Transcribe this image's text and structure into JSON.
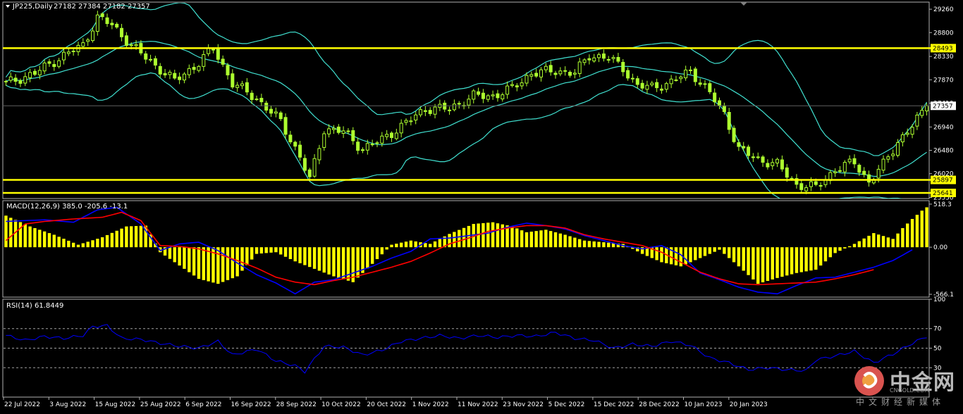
{
  "chart_data": [
    {
      "type": "candlestick",
      "title": "JP225,Daily",
      "ohlc_summary": [
        "27182",
        "27384",
        "27182",
        "27357"
      ],
      "ylim": [
        25530,
        29400
      ],
      "y_ticks": [
        "29260",
        "28800",
        "28330",
        "27870",
        "27410",
        "26940",
        "26480",
        "26020",
        "25550"
      ],
      "x_labels": [
        "22 Jul 2022",
        "3 Aug 2022",
        "15 Aug 2022",
        "25 Aug 2022",
        "6 Sep 2022",
        "16 Sep 2022",
        "28 Sep 2022",
        "10 Oct 2022",
        "20 Oct 2022",
        "1 Nov 2022",
        "11 Nov 2022",
        "23 Nov 2022",
        "5 Dec 2022",
        "15 Dec 2022",
        "28 Dec 2022",
        "10 Jan 2023",
        "20 Jan 2023"
      ],
      "horizontal_levels": [
        28493,
        25897,
        25641
      ],
      "horizontal_level_color": "#ffff00",
      "last_price": 27357,
      "candle_color": "#adff2f",
      "band_color": "#40e0d0",
      "close_keypoints": [
        [
          0,
          27800
        ],
        [
          6,
          28000
        ],
        [
          12,
          28350
        ],
        [
          16,
          28550
        ],
        [
          19,
          29100
        ],
        [
          22,
          28950
        ],
        [
          26,
          28550
        ],
        [
          31,
          28150
        ],
        [
          35,
          27850
        ],
        [
          40,
          28200
        ],
        [
          43,
          28500
        ],
        [
          47,
          27800
        ],
        [
          52,
          27500
        ],
        [
          57,
          27050
        ],
        [
          61,
          26350
        ],
        [
          63,
          25900
        ],
        [
          66,
          26900
        ],
        [
          70,
          26850
        ],
        [
          74,
          26500
        ],
        [
          78,
          26700
        ],
        [
          82,
          26950
        ],
        [
          87,
          27300
        ],
        [
          92,
          27300
        ],
        [
          97,
          27550
        ],
        [
          101,
          27550
        ],
        [
          105,
          27700
        ],
        [
          109,
          28000
        ],
        [
          114,
          28050
        ],
        [
          118,
          28000
        ],
        [
          121,
          28350
        ],
        [
          125,
          28300
        ],
        [
          128,
          28100
        ],
        [
          131,
          27750
        ],
        [
          134,
          27720
        ],
        [
          138,
          27820
        ],
        [
          142,
          28050
        ],
        [
          146,
          27600
        ],
        [
          149,
          27200
        ],
        [
          152,
          26500
        ],
        [
          156,
          26300
        ],
        [
          160,
          26200
        ],
        [
          164,
          25800
        ],
        [
          168,
          25750
        ],
        [
          172,
          26100
        ],
        [
          176,
          26250
        ],
        [
          179,
          25850
        ],
        [
          182,
          26200
        ],
        [
          185,
          26650
        ],
        [
          188,
          26950
        ],
        [
          191,
          27357
        ]
      ]
    },
    {
      "type": "histogram+line",
      "title": "MACD(12,26,9) 385.0 -205.6 -13.1",
      "ylim": [
        -600,
        560
      ],
      "y_ticks": [
        "518.3",
        "0.00",
        "-566.1"
      ],
      "histogram_color": "#ffff00",
      "macd_line_color": "#0000ff",
      "signal_line_color": "#ff0000",
      "histogram_keypoints": [
        [
          0,
          380
        ],
        [
          5,
          250
        ],
        [
          10,
          150
        ],
        [
          15,
          30
        ],
        [
          20,
          120
        ],
        [
          25,
          250
        ],
        [
          29,
          260
        ],
        [
          32,
          -60
        ],
        [
          36,
          -220
        ],
        [
          40,
          -380
        ],
        [
          44,
          -440
        ],
        [
          48,
          -350
        ],
        [
          52,
          -80
        ],
        [
          56,
          -60
        ],
        [
          60,
          -170
        ],
        [
          64,
          -260
        ],
        [
          68,
          -350
        ],
        [
          72,
          -420
        ],
        [
          76,
          -200
        ],
        [
          80,
          30
        ],
        [
          84,
          80
        ],
        [
          88,
          40
        ],
        [
          92,
          160
        ],
        [
          97,
          280
        ],
        [
          101,
          300
        ],
        [
          105,
          250
        ],
        [
          108,
          180
        ],
        [
          112,
          210
        ],
        [
          116,
          150
        ],
        [
          120,
          80
        ],
        [
          124,
          60
        ],
        [
          128,
          40
        ],
        [
          132,
          -80
        ],
        [
          136,
          -180
        ],
        [
          140,
          -230
        ],
        [
          144,
          -130
        ],
        [
          148,
          -30
        ],
        [
          152,
          -230
        ],
        [
          156,
          -440
        ],
        [
          160,
          -370
        ],
        [
          164,
          -310
        ],
        [
          168,
          -270
        ],
        [
          172,
          -70
        ],
        [
          176,
          40
        ],
        [
          180,
          170
        ],
        [
          184,
          100
        ],
        [
          186,
          230
        ],
        [
          188,
          340
        ],
        [
          190,
          440
        ],
        [
          191,
          480
        ]
      ],
      "macd_keypoints": [
        [
          0,
          310
        ],
        [
          8,
          330
        ],
        [
          14,
          300
        ],
        [
          19,
          450
        ],
        [
          23,
          480
        ],
        [
          28,
          280
        ],
        [
          32,
          -40
        ],
        [
          36,
          40
        ],
        [
          40,
          60
        ],
        [
          44,
          -40
        ],
        [
          48,
          -190
        ],
        [
          52,
          -330
        ],
        [
          56,
          -430
        ],
        [
          60,
          -560
        ],
        [
          64,
          -420
        ],
        [
          68,
          -390
        ],
        [
          72,
          -310
        ],
        [
          76,
          -230
        ],
        [
          80,
          -130
        ],
        [
          84,
          -50
        ],
        [
          88,
          100
        ],
        [
          92,
          110
        ],
        [
          96,
          140
        ],
        [
          100,
          170
        ],
        [
          104,
          240
        ],
        [
          108,
          290
        ],
        [
          112,
          260
        ],
        [
          116,
          220
        ],
        [
          120,
          140
        ],
        [
          124,
          80
        ],
        [
          128,
          20
        ],
        [
          132,
          -20
        ],
        [
          136,
          20
        ],
        [
          140,
          -90
        ],
        [
          144,
          -310
        ],
        [
          148,
          -390
        ],
        [
          152,
          -480
        ],
        [
          156,
          -540
        ],
        [
          160,
          -560
        ],
        [
          164,
          -460
        ],
        [
          168,
          -370
        ],
        [
          172,
          -360
        ],
        [
          176,
          -300
        ],
        [
          180,
          -240
        ],
        [
          184,
          -160
        ],
        [
          188,
          -30
        ]
      ],
      "signal_keypoints": [
        [
          0,
          80
        ],
        [
          4,
          280
        ],
        [
          8,
          310
        ],
        [
          14,
          340
        ],
        [
          20,
          360
        ],
        [
          24,
          420
        ],
        [
          28,
          320
        ],
        [
          32,
          20
        ],
        [
          36,
          10
        ],
        [
          40,
          -20
        ],
        [
          44,
          -80
        ],
        [
          48,
          -160
        ],
        [
          52,
          -250
        ],
        [
          56,
          -360
        ],
        [
          60,
          -420
        ],
        [
          64,
          -450
        ],
        [
          68,
          -400
        ],
        [
          72,
          -360
        ],
        [
          76,
          -300
        ],
        [
          80,
          -240
        ],
        [
          84,
          -170
        ],
        [
          88,
          -70
        ],
        [
          92,
          40
        ],
        [
          96,
          110
        ],
        [
          100,
          190
        ],
        [
          104,
          230
        ],
        [
          108,
          260
        ],
        [
          112,
          260
        ],
        [
          116,
          230
        ],
        [
          120,
          150
        ],
        [
          124,
          100
        ],
        [
          128,
          60
        ],
        [
          132,
          20
        ],
        [
          136,
          -60
        ],
        [
          140,
          -180
        ],
        [
          144,
          -300
        ],
        [
          148,
          -380
        ],
        [
          152,
          -440
        ],
        [
          156,
          -450
        ],
        [
          160,
          -440
        ],
        [
          164,
          -430
        ],
        [
          168,
          -420
        ],
        [
          172,
          -380
        ],
        [
          176,
          -330
        ],
        [
          180,
          -270
        ]
      ]
    },
    {
      "type": "line",
      "title": "RSI(14) 61.8449",
      "ylim": [
        0,
        100
      ],
      "y_ticks": [
        "100",
        "70",
        "50",
        "30"
      ],
      "dashed_levels": [
        70,
        50,
        30
      ],
      "line_color": "#0000ff",
      "values_keypoints": [
        [
          0,
          63
        ],
        [
          4,
          58
        ],
        [
          8,
          62
        ],
        [
          12,
          60
        ],
        [
          16,
          63
        ],
        [
          18,
          72
        ],
        [
          21,
          73
        ],
        [
          24,
          60
        ],
        [
          28,
          59
        ],
        [
          32,
          55
        ],
        [
          36,
          52
        ],
        [
          40,
          50
        ],
        [
          44,
          57
        ],
        [
          47,
          43
        ],
        [
          52,
          49
        ],
        [
          56,
          37
        ],
        [
          60,
          32
        ],
        [
          62,
          26
        ],
        [
          66,
          52
        ],
        [
          70,
          51
        ],
        [
          74,
          43
        ],
        [
          78,
          48
        ],
        [
          82,
          57
        ],
        [
          86,
          60
        ],
        [
          90,
          63
        ],
        [
          94,
          60
        ],
        [
          98,
          63
        ],
        [
          102,
          61
        ],
        [
          106,
          63
        ],
        [
          110,
          62
        ],
        [
          114,
          66
        ],
        [
          118,
          60
        ],
        [
          122,
          58
        ],
        [
          126,
          50
        ],
        [
          130,
          54
        ],
        [
          134,
          52
        ],
        [
          138,
          57
        ],
        [
          142,
          53
        ],
        [
          146,
          40
        ],
        [
          150,
          35
        ],
        [
          154,
          28
        ],
        [
          158,
          30
        ],
        [
          162,
          28
        ],
        [
          166,
          27
        ],
        [
          168,
          38
        ],
        [
          172,
          42
        ],
        [
          176,
          47
        ],
        [
          180,
          35
        ],
        [
          184,
          44
        ],
        [
          188,
          55
        ],
        [
          191,
          62
        ]
      ]
    }
  ],
  "watermark": {
    "brand_cn": "中金网",
    "brand_en": "CNGOLD.COM",
    "subtitle_cn": "中文财经新媒体"
  }
}
